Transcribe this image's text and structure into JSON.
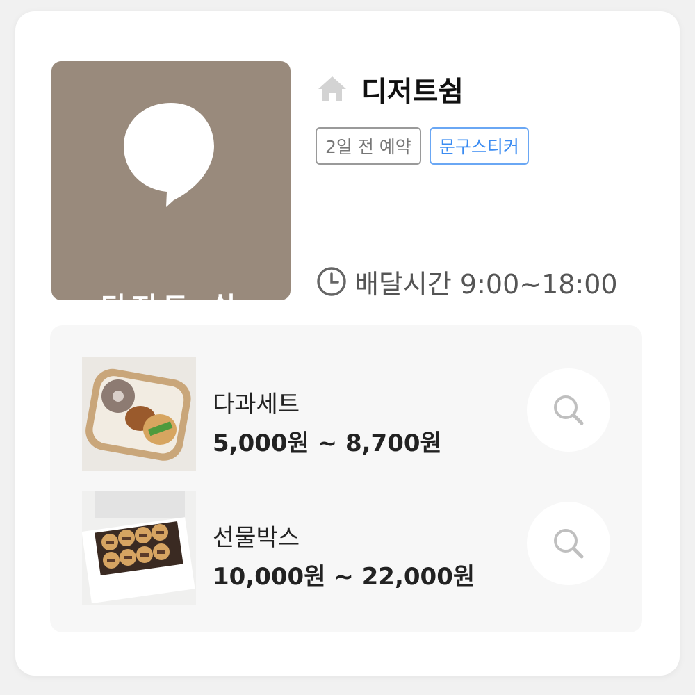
{
  "store": {
    "name": "디저트쉼",
    "logo_text": "디저트;쉼",
    "badges": [
      {
        "label": "2일 전 예약"
      },
      {
        "label": "문구스티커"
      }
    ],
    "hours": "배달시간 9:00~18:00"
  },
  "products": [
    {
      "name": "다과세트",
      "price": "5,000원 ~ 8,700원"
    },
    {
      "name": "선물박스",
      "price": "10,000원 ~ 22,000원"
    }
  ],
  "colors": {
    "logo_bg": "#998a7c",
    "accent_blue": "#3b8cf2",
    "panel_bg": "#f7f7f7"
  },
  "icons": {
    "home": "home-icon",
    "clock": "clock-icon",
    "search": "search-icon"
  }
}
